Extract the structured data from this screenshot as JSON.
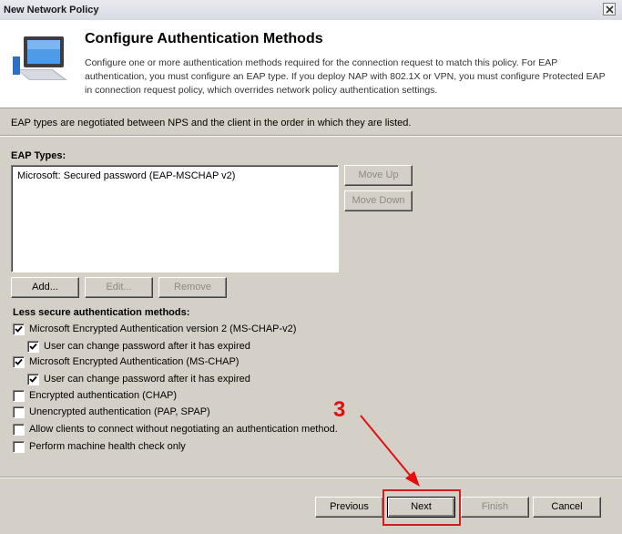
{
  "window": {
    "title": "New Network Policy"
  },
  "header": {
    "title": "Configure Authentication Methods",
    "description": "Configure one or more authentication methods required for the connection request to match this policy. For EAP authentication, you must configure an EAP type. If you deploy NAP with 802.1X or VPN, you must configure Protected EAP in connection request policy, which overrides network policy authentication settings.",
    "icon": "network-computer-icon"
  },
  "info_text": "EAP types are negotiated between NPS and the client in the order in which they are listed.",
  "eap": {
    "label": "EAP Types:",
    "items": [
      "Microsoft: Secured password (EAP-MSCHAP v2)"
    ],
    "move_up": "Move Up",
    "move_down": "Move Down",
    "add": "Add...",
    "edit": "Edit...",
    "remove": "Remove"
  },
  "less_secure": {
    "label": "Less secure authentication methods:",
    "options": [
      {
        "label": "Microsoft Encrypted Authentication version 2 (MS-CHAP-v2)",
        "checked": true
      },
      {
        "label": "User can change password after it has expired",
        "checked": true
      },
      {
        "label": "Microsoft Encrypted Authentication (MS-CHAP)",
        "checked": true
      },
      {
        "label": "User can change password after it has expired",
        "checked": true
      },
      {
        "label": "Encrypted authentication (CHAP)",
        "checked": false
      },
      {
        "label": "Unencrypted authentication (PAP, SPAP)",
        "checked": false
      },
      {
        "label": "Allow clients to connect without negotiating an authentication method.",
        "checked": false
      },
      {
        "label": "Perform machine health check only",
        "checked": false
      }
    ]
  },
  "footer": {
    "previous": "Previous",
    "next": "Next",
    "finish": "Finish",
    "cancel": "Cancel"
  },
  "annotation": {
    "step_number": "3",
    "color": "#e01010"
  }
}
